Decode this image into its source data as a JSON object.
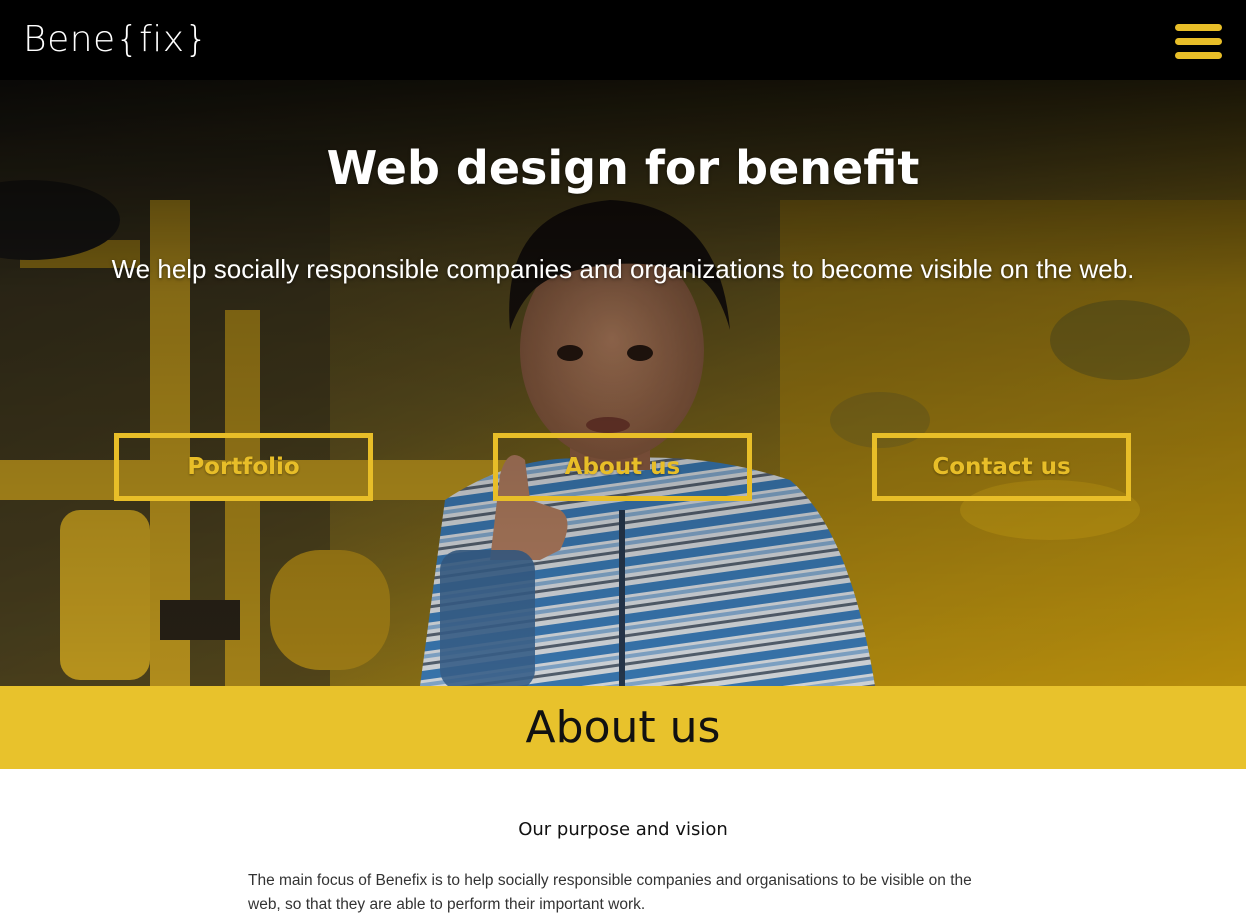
{
  "header": {
    "logo": "Bene{fix}",
    "menu_icon": "hamburger-menu-icon"
  },
  "hero": {
    "title": "Web design for benefit",
    "subtitle": "We help socially responsible companies and organizations to become visible on the web.",
    "buttons": [
      {
        "label": "Portfolio"
      },
      {
        "label": "About us"
      },
      {
        "label": "Contact us"
      }
    ]
  },
  "about": {
    "heading": "About us",
    "subheading": "Our purpose and vision",
    "paragraph": "The main focus of Benefix is to help socially responsible companies and organisations to be visible on the web, so that they are able to perform their important work."
  },
  "colors": {
    "accent_yellow": "#e8be28",
    "band_yellow": "#e8c22c",
    "header_black": "#000000"
  }
}
